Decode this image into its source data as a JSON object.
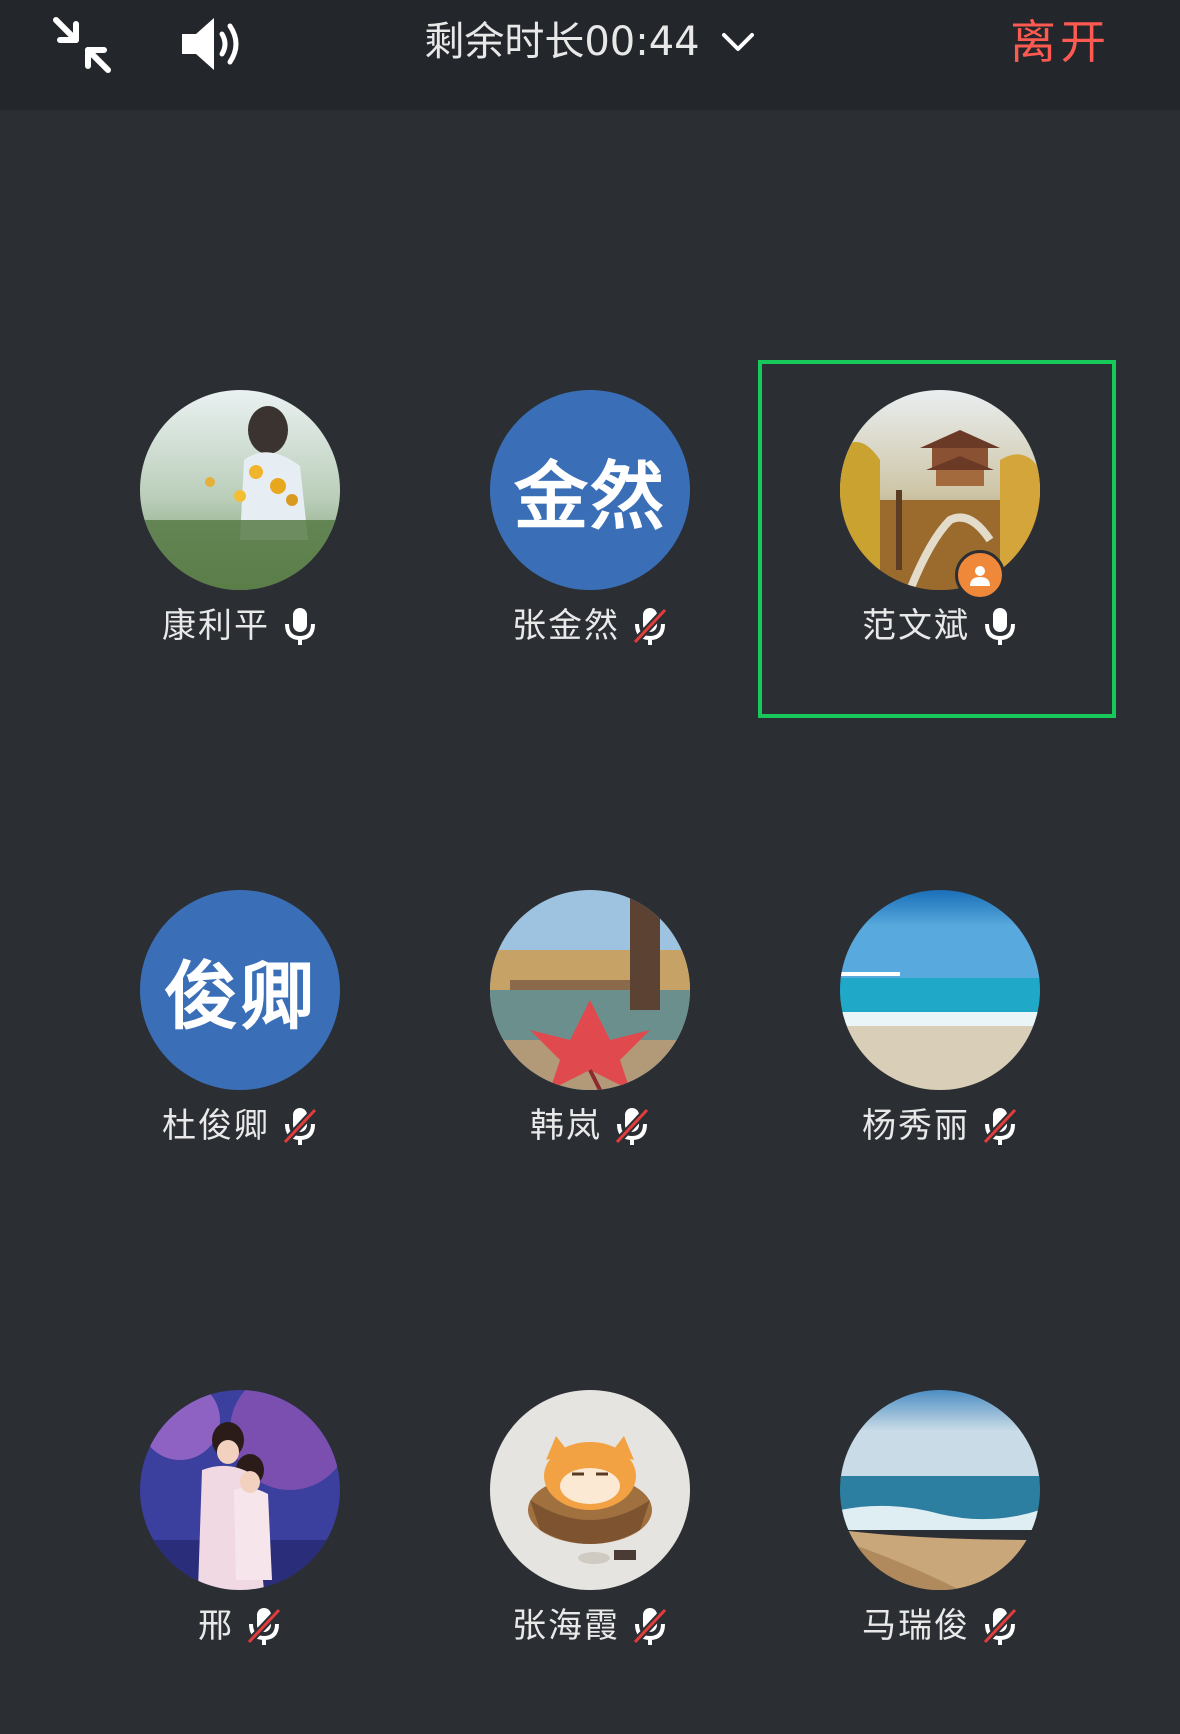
{
  "topbar": {
    "timer_text": "剩余时长00:44",
    "leave_label": "离开",
    "icons": [
      "shrink-icon",
      "speaker-icon",
      "chevron-down-icon"
    ]
  },
  "colors": {
    "background": "#2b2e33",
    "topbar": "#23262a",
    "leave": "#ff5a52",
    "text_avatar": "#3a6fb8",
    "selected_border": "#17c95a",
    "host_badge": "#f0883a",
    "muted_slash": "#e23c3c"
  },
  "participants": [
    {
      "name": "康利平",
      "mic": "on",
      "avatar_type": "photo",
      "avatar_desc": "girl-in-sunflower-field"
    },
    {
      "name": "张金然",
      "mic": "muted",
      "avatar_type": "text",
      "avatar_text": "金然"
    },
    {
      "name": "范文斌",
      "mic": "on",
      "avatar_type": "photo",
      "avatar_desc": "pavilion-autumn",
      "host": true,
      "selected": true
    },
    {
      "name": "杜俊卿",
      "mic": "muted",
      "avatar_type": "text",
      "avatar_text": "俊卿"
    },
    {
      "name": "韩岚",
      "mic": "muted",
      "avatar_type": "photo",
      "avatar_desc": "pier-maple-leaf"
    },
    {
      "name": "杨秀丽",
      "mic": "muted",
      "avatar_type": "photo",
      "avatar_desc": "sea-beach"
    },
    {
      "name": "邢",
      "mic": "muted",
      "avatar_type": "photo",
      "avatar_desc": "two-girls-purple-tree"
    },
    {
      "name": "张海霞",
      "mic": "muted",
      "avatar_type": "photo",
      "avatar_desc": "cat-in-basket"
    },
    {
      "name": "马瑞俊",
      "mic": "muted",
      "avatar_type": "photo",
      "avatar_desc": "ocean-waves-beach"
    }
  ]
}
